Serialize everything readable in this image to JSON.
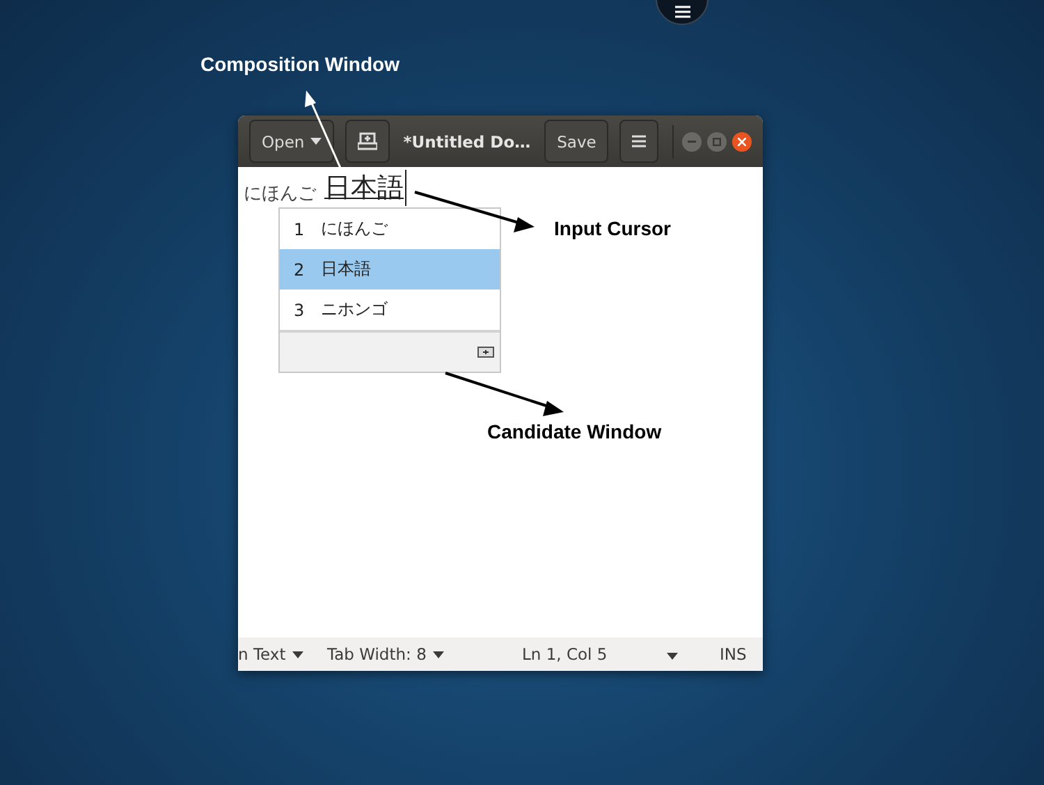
{
  "annotations": [
    {
      "label": "Composition Window"
    },
    {
      "label": "Input Cursor"
    },
    {
      "label": "Candidate Window"
    }
  ],
  "window": {
    "open_button": "Open",
    "title": "*Untitled Do…",
    "save_button": "Save"
  },
  "editor": {
    "committed_text": "にほんご",
    "preedit_text": "日本語"
  },
  "candidates": [
    {
      "number": "1",
      "text": "にほんご",
      "selected": false
    },
    {
      "number": "2",
      "text": "日本語",
      "selected": true
    },
    {
      "number": "3",
      "text": "ニホンゴ",
      "selected": false
    }
  ],
  "status_bar": {
    "language": "n Text",
    "tab_width": "Tab Width: 8",
    "position": "Ln 1, Col 5",
    "mode": "INS"
  }
}
